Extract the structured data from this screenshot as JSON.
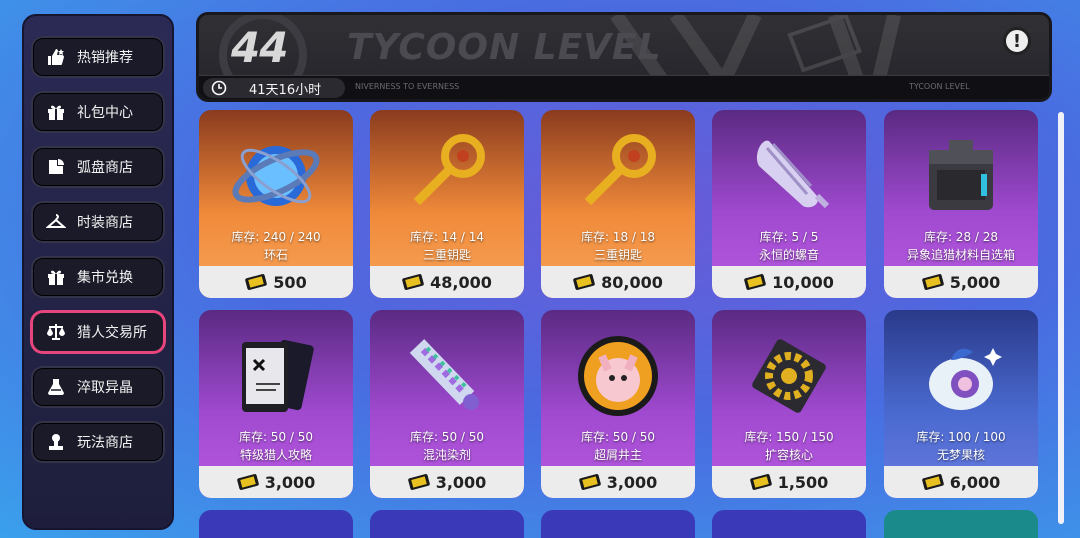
{
  "sidebar": {
    "items": [
      {
        "label": "热销推荐",
        "icon": "thumbs-up-icon"
      },
      {
        "label": "礼包中心",
        "icon": "gift-icon"
      },
      {
        "label": "弧盘商店",
        "icon": "disc-icon"
      },
      {
        "label": "时装商店",
        "icon": "hanger-icon"
      },
      {
        "label": "集市兑换",
        "icon": "gift-box-icon"
      },
      {
        "label": "猎人交易所",
        "icon": "scale-icon",
        "active": true
      },
      {
        "label": "淬取异晶",
        "icon": "flask-icon"
      },
      {
        "label": "玩法商店",
        "icon": "trophy-icon"
      }
    ]
  },
  "banner": {
    "level": "44",
    "title": "TYCOON LEVEL",
    "timer": "41天16小时",
    "subtitle": "NIVERNESS TO EVERNESS",
    "right_tag": "TYCOON LEVEL"
  },
  "items": [
    {
      "stock": "库存: 240 / 240",
      "name": "环石",
      "price": "500",
      "bg": "orange",
      "icon": "ring-stone-icon"
    },
    {
      "stock": "库存: 14 / 14",
      "name": "三重钥匙",
      "price": "48,000",
      "bg": "orange",
      "icon": "key-icon"
    },
    {
      "stock": "库存: 18 / 18",
      "name": "三重钥匙",
      "price": "80,000",
      "bg": "orange",
      "icon": "key-icon"
    },
    {
      "stock": "库存: 5 / 5",
      "name": "永恒的螺音",
      "price": "10,000",
      "bg": "purple",
      "icon": "conch-icon"
    },
    {
      "stock": "库存: 28 / 28",
      "name": "异象追猎材料自选箱",
      "price": "5,000",
      "bg": "purple",
      "icon": "chest-icon"
    },
    {
      "stock": "库存: 50 / 50",
      "name": "特级猎人攻略",
      "price": "3,000",
      "bg": "purple",
      "icon": "cards-icon"
    },
    {
      "stock": "库存: 50 / 50",
      "name": "混沌染剂",
      "price": "3,000",
      "bg": "purple",
      "icon": "dye-icon"
    },
    {
      "stock": "库存: 50 / 50",
      "name": "超屑井主",
      "price": "3,000",
      "bg": "purple",
      "icon": "badge-icon"
    },
    {
      "stock": "库存: 150 / 150",
      "name": "扩容核心",
      "price": "1,500",
      "bg": "purple",
      "icon": "gear-core-icon"
    },
    {
      "stock": "库存: 100 / 100",
      "name": "无梦果核",
      "price": "6,000",
      "bg": "blue",
      "icon": "fruit-core-icon"
    }
  ],
  "colors": {
    "active_border": "#e7457d",
    "orange_card": "#f08a3a",
    "purple_card": "#a04ad0",
    "blue_card": "#4a6ad0"
  }
}
